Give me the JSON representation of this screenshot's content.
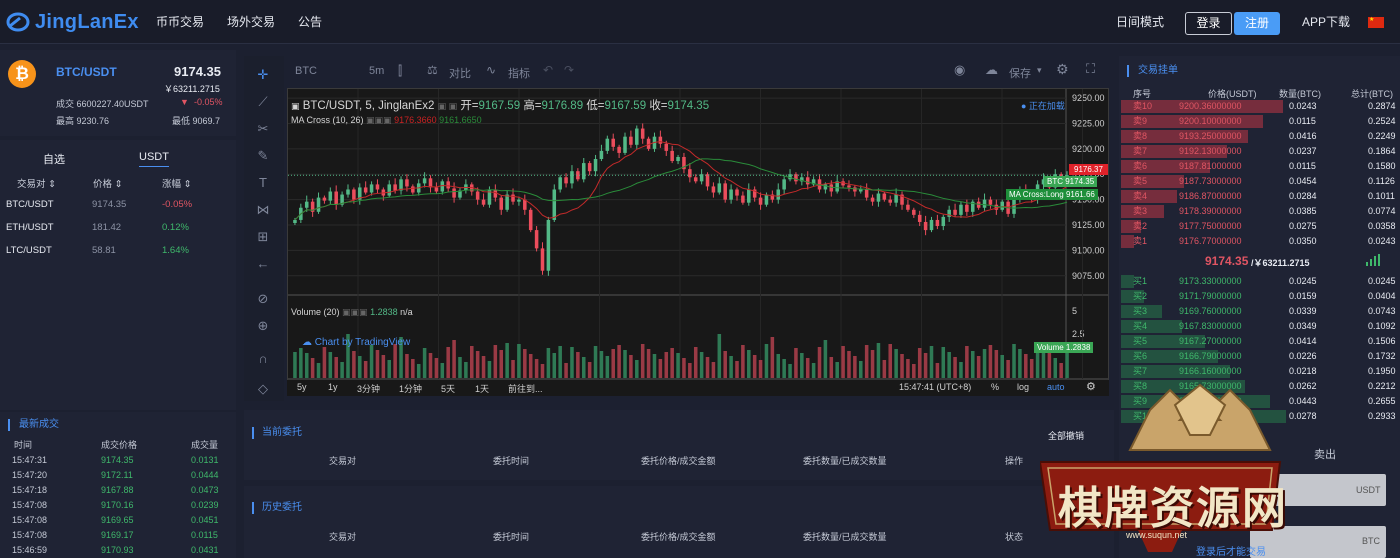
{
  "header": {
    "logo": "JingLanEx",
    "nav": [
      "币币交易",
      "场外交易",
      "公告"
    ],
    "day_mode": "日间模式",
    "login": "登录",
    "register": "注册",
    "app": "APP下载"
  },
  "pair": {
    "name": "BTC/USDT",
    "price": "9174.35",
    "cny": "￥63211.2715",
    "volume": "成交 6600227.40USDT",
    "change": "-0.05%",
    "high": "最高 9230.76",
    "low": "最低 9069.7"
  },
  "market": {
    "tabs": [
      "自选",
      "USDT"
    ],
    "headers": [
      "交易对",
      "价格",
      "涨幅"
    ],
    "rows": [
      {
        "pair": "BTC/USDT",
        "price": "9174.35",
        "change": "-0.05%",
        "up": false
      },
      {
        "pair": "ETH/USDT",
        "price": "181.42",
        "change": "0.12%",
        "up": true
      },
      {
        "pair": "LTC/USDT",
        "price": "58.81",
        "change": "1.64%",
        "up": true
      }
    ]
  },
  "chart_toolbar": {
    "symbol": "BTC",
    "interval": "5m",
    "compare": "对比",
    "indicators": "指标",
    "save": "保存"
  },
  "chart": {
    "legend": "BTC/USDT, 5, JinglanEx2",
    "open_l": "开=",
    "open": "9167.59",
    "high_l": "高=",
    "high": "9176.89",
    "low_l": "低=",
    "low": "9167.59",
    "close_l": "收=",
    "close": "9174.35",
    "loading": "● 正在加载",
    "ma_label": "MA Cross (10, 26)",
    "ma1": "9176.3660",
    "ma2": "9161.6650",
    "vol_label": "Volume (20)",
    "vol_value": "1.2838",
    "vol_na": "n/a",
    "watermark": "Chart by TradingView",
    "tag_price": "9176.37",
    "tag_btc": "BTC",
    "tag_btc_val": "9174.35",
    "tag_ma": "MA Cross:Long",
    "tag_ma_val": "9161.66",
    "tag_vol": "Volume",
    "tag_vol_val": "1.2838",
    "y_labels": [
      "9250.00",
      "9225.00",
      "9200.00",
      "9175.00",
      "9150.00",
      "9125.00",
      "9100.00",
      "9075.00"
    ],
    "vol_axis": [
      "5",
      "2.5"
    ],
    "x_labels": [
      "03:00",
      "04:30",
      "06:00",
      "07:30",
      "09:00",
      "10:30",
      "12:00",
      "13:30",
      "15:00",
      "16:0"
    ],
    "ranges": [
      "5y",
      "1y",
      "3分钟",
      "1分钟",
      "5天",
      "1天",
      "前往到..."
    ],
    "time": "15:47:41 (UTC+8)",
    "pct": "%",
    "log": "log",
    "auto": "auto"
  },
  "chart_data": {
    "type": "candlestick",
    "ylim": [
      9062,
      9255
    ],
    "closes": [
      9130,
      9142,
      9148,
      9138,
      9152,
      9149,
      9158,
      9145,
      9155,
      9160,
      9150,
      9162,
      9157,
      9165,
      9160,
      9154,
      9165,
      9159,
      9170,
      9163,
      9157,
      9166,
      9171,
      9162,
      9158,
      9168,
      9161,
      9152,
      9159,
      9165,
      9158,
      9150,
      9145,
      9160,
      9152,
      9140,
      9155,
      9148,
      9150,
      9140,
      9120,
      9102,
      9080,
      9130,
      9160,
      9172,
      9166,
      9178,
      9170,
      9186,
      9178,
      9190,
      9198,
      9210,
      9202,
      9196,
      9212,
      9204,
      9220,
      9210,
      9200,
      9212,
      9205,
      9198,
      9188,
      9192,
      9180,
      9172,
      9168,
      9175,
      9163,
      9157,
      9166,
      9150,
      9160,
      9154,
      9147,
      9160,
      9152,
      9145,
      9155,
      9150,
      9160,
      9170,
      9175,
      9168,
      9172,
      9165,
      9170,
      9160,
      9165,
      9158,
      9168,
      9164,
      9162,
      9158,
      9160,
      9152,
      9148,
      9156,
      9150,
      9147,
      9155,
      9145,
      9140,
      9135,
      9128,
      9120,
      9130,
      9124,
      9133,
      9140,
      9135,
      9145,
      9138,
      9148,
      9142,
      9150,
      9145,
      9140,
      9148,
      9136,
      9152,
      9160,
      9155,
      9150,
      9165,
      9170,
      9162,
      9175,
      9168,
      9174
    ]
  },
  "orderbook": {
    "title": "交易挂单",
    "headers": [
      "序号",
      "价格(USDT)",
      "数量(BTC)",
      "总计(BTC)"
    ],
    "asks": [
      [
        "卖10",
        "9200.36000000",
        "0.0243",
        "0.2874"
      ],
      [
        "卖9",
        "9200.10000000",
        "0.0115",
        "0.2524"
      ],
      [
        "卖8",
        "9193.25000000",
        "0.0416",
        "0.2249"
      ],
      [
        "卖7",
        "9192.13000000",
        "0.0237",
        "0.1864"
      ],
      [
        "卖6",
        "9187.81000000",
        "0.0115",
        "0.1580"
      ],
      [
        "卖5",
        "9187.73000000",
        "0.0454",
        "0.1126"
      ],
      [
        "卖4",
        "9186.87000000",
        "0.0284",
        "0.1011"
      ],
      [
        "卖3",
        "9178.39000000",
        "0.0385",
        "0.0774"
      ],
      [
        "卖2",
        "9177.75000000",
        "0.0275",
        "0.0358"
      ],
      [
        "卖1",
        "9176.77000000",
        "0.0350",
        "0.0243"
      ]
    ],
    "mid_price": "9174.35",
    "mid_cny": "/￥63211.2715",
    "bids": [
      [
        "买1",
        "9173.33000000",
        "0.0245",
        "0.0245"
      ],
      [
        "买2",
        "9171.79000000",
        "0.0159",
        "0.0404"
      ],
      [
        "买3",
        "9169.76000000",
        "0.0339",
        "0.0743"
      ],
      [
        "买4",
        "9167.83000000",
        "0.0349",
        "0.1092"
      ],
      [
        "买5",
        "9167.27000000",
        "0.0414",
        "0.1506"
      ],
      [
        "买6",
        "9166.79000000",
        "0.0226",
        "0.1732"
      ],
      [
        "买7",
        "9166.16000000",
        "0.0218",
        "0.1950"
      ],
      [
        "买8",
        "9165.73000000",
        "0.0262",
        "0.2212"
      ],
      [
        "买9",
        "9165.01000000",
        "0.0443",
        "0.2655"
      ],
      [
        "买10",
        "9164.59000000",
        "0.0278",
        "0.2933"
      ]
    ],
    "ask_depth": [
      0.98,
      0.86,
      0.77,
      0.64,
      0.54,
      0.38,
      0.34,
      0.26,
      0.12,
      0.08
    ],
    "bid_depth": [
      0.08,
      0.14,
      0.25,
      0.37,
      0.51,
      0.59,
      0.66,
      0.75,
      0.9,
      1.0
    ]
  },
  "trades": {
    "title": "最新成交",
    "headers": [
      "时间",
      "成交价格",
      "成交量"
    ],
    "rows": [
      [
        "15:47:31",
        "9174.35",
        "0.0131"
      ],
      [
        "15:47:20",
        "9172.11",
        "0.0444"
      ],
      [
        "15:47:18",
        "9167.88",
        "0.0473"
      ],
      [
        "15:47:08",
        "9170.16",
        "0.0239"
      ],
      [
        "15:47:08",
        "9169.65",
        "0.0451"
      ],
      [
        "15:47:08",
        "9169.17",
        "0.0115"
      ],
      [
        "15:46:59",
        "9170.93",
        "0.0431"
      ]
    ]
  },
  "current_orders": {
    "title": "当前委托",
    "cancel_all": "全部撤销",
    "headers": [
      "交易对",
      "委托时间",
      "委托价格/成交金额",
      "委托数量/已成交数量",
      "操作"
    ]
  },
  "history_orders": {
    "title": "历史委托",
    "headers": [
      "交易对",
      "委托时间",
      "委托价格/成交金额",
      "委托数量/已成交数量",
      "状态"
    ]
  },
  "trade_form": {
    "sell": "卖出",
    "usdt": "USDT",
    "btc": "BTC",
    "login_hint": "登录后才能交易"
  },
  "watermark": {
    "text": "棋牌资源网",
    "url": "www.suqun.net"
  }
}
